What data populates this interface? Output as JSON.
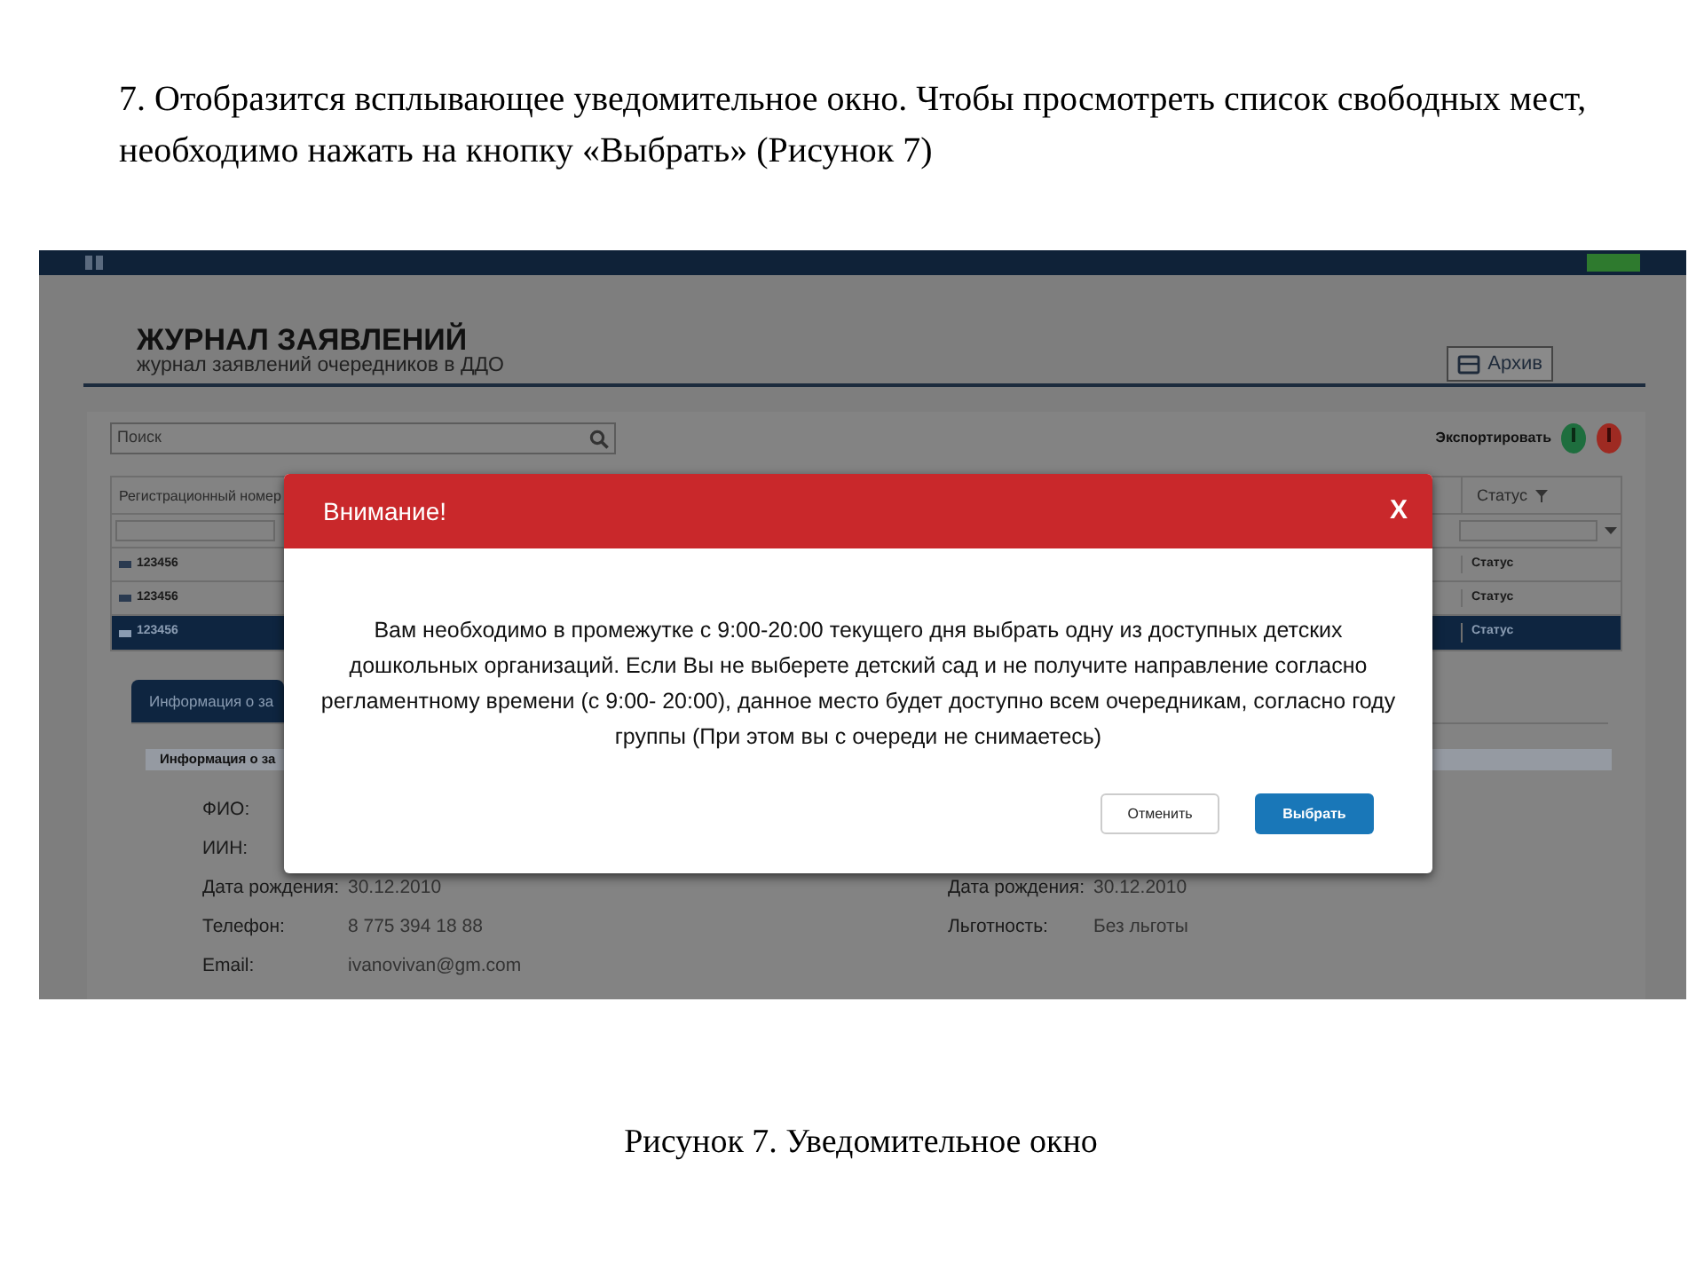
{
  "instruction": "7. Отобразится всплывающее уведомительное окно. Чтобы просмотреть список свободных мест, необходимо нажать на кнопку «Выбрать» (Рисунок 7)",
  "screenshot": {
    "page_title": "ЖУРНАЛ ЗАЯВЛЕНИЙ",
    "page_subtitle": "журнал заявлений очередников в ДДО",
    "archive_button": "Архив",
    "search": {
      "placeholder": "Поиск"
    },
    "export_label": "Экспортировать",
    "table": {
      "columns": [
        "Регистрационный номер",
        "Статус"
      ],
      "rows": [
        {
          "number": "123456",
          "status": "Статус",
          "selected": false
        },
        {
          "number": "123456",
          "status": "Статус",
          "selected": false
        },
        {
          "number": "123456",
          "status": "Статус",
          "selected": true
        }
      ]
    },
    "tab": "Информация о за",
    "section": "Информация о за",
    "fields_left": [
      {
        "label": "ФИО:"
      },
      {
        "label": "ИИН:"
      },
      {
        "label": "Дата рождения:",
        "value": "30.12.2010"
      },
      {
        "label": "Телефон:",
        "value": "8 775 394 18 88"
      },
      {
        "label": "Email:",
        "value": "ivanovivan@gm.com"
      }
    ],
    "fields_right": [
      {
        "label": "Дата рождения:",
        "value": "30.12.2010"
      },
      {
        "label": "Льготность:",
        "value": "Без льготы"
      }
    ],
    "dialog": {
      "title": "Внимание!",
      "close": "X",
      "message": "Вам необходимо  в промежутке с 9:00-20:00 текущего дня выбрать одну из доступных детских дошкольных организаций. Если Вы не выберете детский сад и не получите направление согласно регламентному времени (с 9:00- 20:00), данное место будет доступно всем очередникам, согласно году группы (При этом вы с очереди не снимаетесь)",
      "buttons": [
        {
          "label": "Отменить",
          "kind": "secondary"
        },
        {
          "label": "Выбрать",
          "kind": "primary"
        }
      ]
    }
  },
  "caption": "Рисунок 7. Уведомительное окно"
}
